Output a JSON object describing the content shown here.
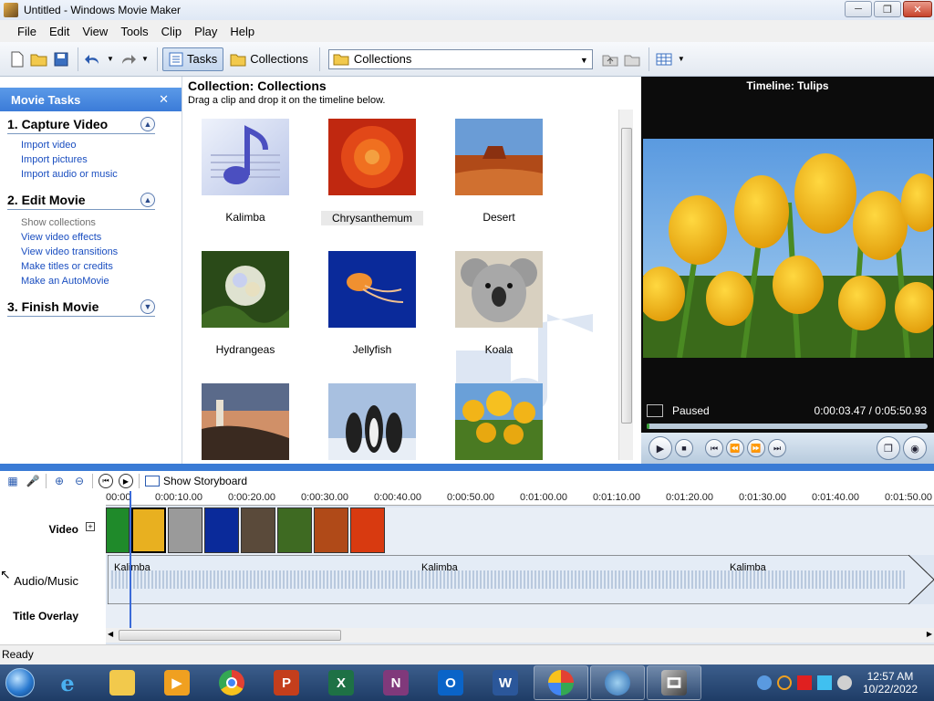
{
  "window": {
    "title": "Untitled - Windows Movie Maker"
  },
  "menu": [
    "File",
    "Edit",
    "View",
    "Tools",
    "Clip",
    "Play",
    "Help"
  ],
  "toolbar": {
    "tasks_label": "Tasks",
    "collections_label": "Collections",
    "collections_select": "Collections"
  },
  "taskpane": {
    "header": "Movie Tasks",
    "sections": [
      {
        "title": "1. Capture Video",
        "links": [
          "Import video",
          "Import pictures",
          "Import audio or music"
        ]
      },
      {
        "title": "2. Edit Movie",
        "links": [
          "Show collections",
          "View video effects",
          "View video transitions",
          "Make titles or credits",
          "Make an AutoMovie"
        ]
      },
      {
        "title": "3. Finish Movie",
        "links": []
      }
    ]
  },
  "collection": {
    "title": "Collection: Collections",
    "subtitle": "Drag a clip and drop it on the timeline below.",
    "clips": [
      "Kalimba",
      "Chrysanthemum",
      "Desert",
      "Hydrangeas",
      "Jellyfish",
      "Koala"
    ]
  },
  "preview": {
    "title": "Timeline: Tulips",
    "status": "Paused",
    "time": "0:00:03.47 / 0:05:50.93"
  },
  "timeline": {
    "show_storyboard": "Show Storyboard",
    "tracks": {
      "video": "Video",
      "audio": "Audio/Music",
      "title": "Title Overlay"
    },
    "ticks": [
      "00:00",
      "0:00:10.00",
      "0:00:20.00",
      "0:00:30.00",
      "0:00:40.00",
      "0:00:50.00",
      "0:01:00.00",
      "0:01:10.00",
      "0:01:20.00",
      "0:01:30.00",
      "0:01:40.00",
      "0:01:50.00"
    ],
    "audio_labels": [
      "Kalimba",
      "Kalimba",
      "Kalimba"
    ]
  },
  "status": {
    "text": "Ready"
  },
  "clock": {
    "time": "12:57 AM",
    "date": "10/22/2022"
  },
  "colors": {
    "accent": "#3a7bd5",
    "task_header": "#4a8be0",
    "link": "#1a4ec0"
  }
}
